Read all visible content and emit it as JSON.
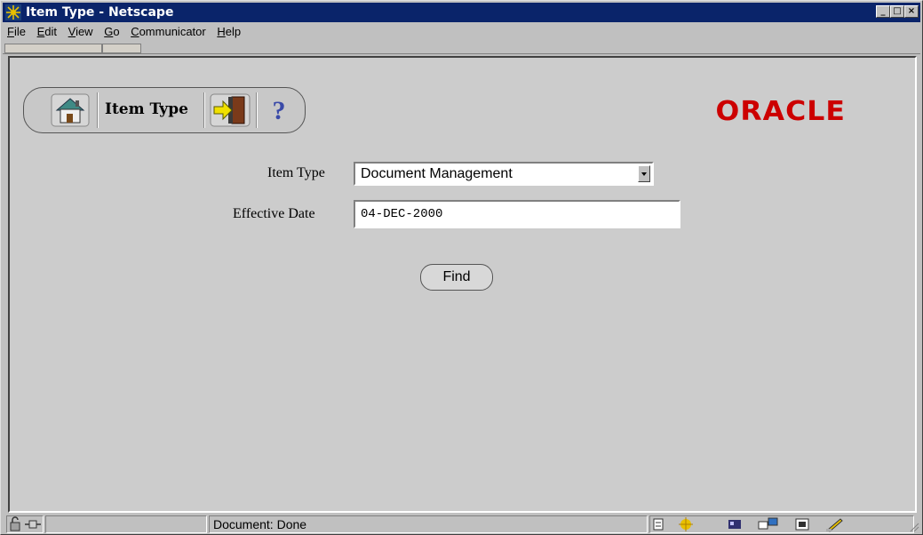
{
  "window": {
    "title": "Item Type - Netscape"
  },
  "menu": [
    "File",
    "Edit",
    "View",
    "Go",
    "Communicator",
    "Help"
  ],
  "toolbar": {
    "label": "Item Type",
    "help_glyph": "?"
  },
  "logo": {
    "text": "ORACLE",
    "color": "#cc0000"
  },
  "form": {
    "item_type_label": "Item Type",
    "item_type_value": "Document Management",
    "effective_date_label": "Effective Date",
    "effective_date_value": "04-DEC-2000",
    "find_label": "Find"
  },
  "status": {
    "text": "Document: Done"
  }
}
